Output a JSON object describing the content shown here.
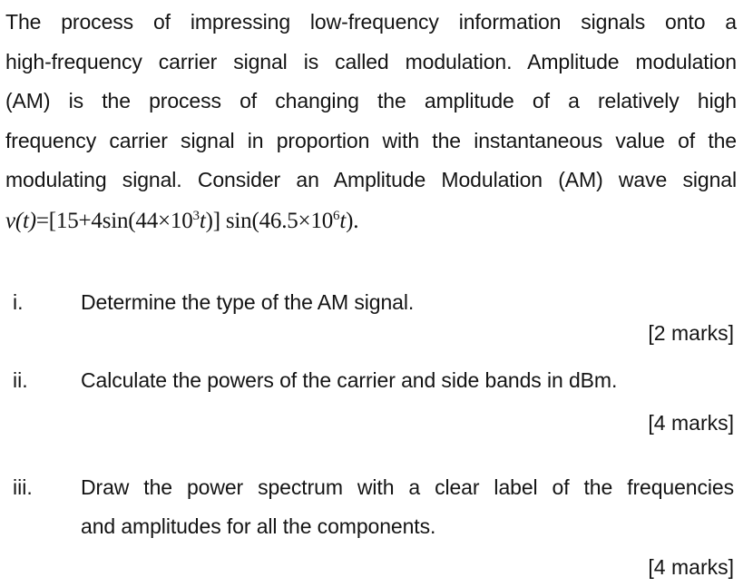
{
  "intro": {
    "lines": [
      "The process of impressing low-frequency information signals onto a",
      "high-frequency carrier signal is called modulation. Amplitude modulation",
      "(AM) is the process of changing the amplitude of a relatively high",
      "frequency carrier signal in proportion with the instantaneous value of the",
      "modulating signal. Consider an Amplitude Modulation (AM) wave signal"
    ],
    "formula": {
      "lhs": "v(t)",
      "eq": "=[15+4sin(44×10",
      "exp1": "3",
      "t1": "t",
      "mid": ")] sin(46.5×10",
      "exp2": "6",
      "t2": "t",
      "end": ")."
    }
  },
  "questions": [
    {
      "number": "i.",
      "lines": [
        "Determine the type of the AM signal."
      ],
      "marks": "[2 marks]"
    },
    {
      "number": "ii.",
      "lines": [
        "Calculate the powers of the carrier and side bands in dBm."
      ],
      "marks": "[4 marks]"
    },
    {
      "number": "iii.",
      "lines": [
        "Draw the power spectrum with a clear label of the frequencies",
        "and amplitudes for all the components."
      ],
      "marks": "[4 marks]"
    }
  ]
}
